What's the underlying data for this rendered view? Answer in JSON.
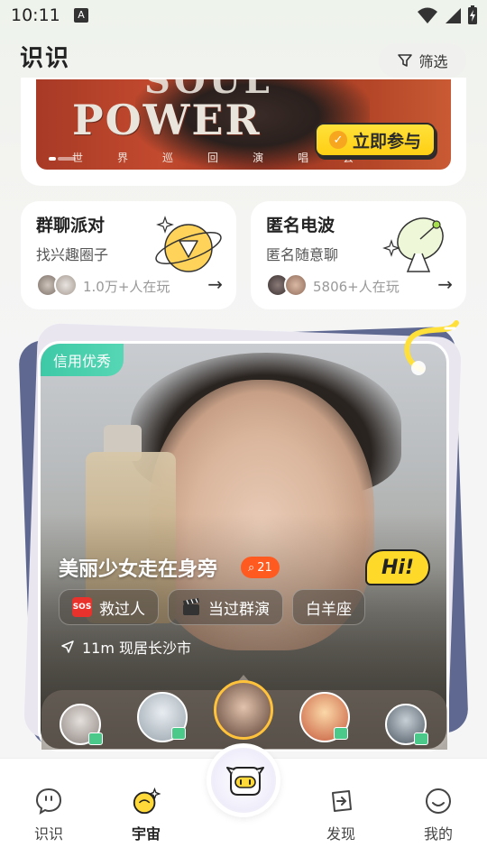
{
  "status_bar": {
    "time": "10:11",
    "notification_icon": "A"
  },
  "header": {
    "title": "识识",
    "filter_label": "筛选"
  },
  "banner": {
    "headline_top": "SOUL",
    "headline": "POWER",
    "subtitle_chars": [
      "世",
      "界",
      "巡",
      "回",
      "演",
      "唱",
      "会"
    ],
    "join_label": "立即参与"
  },
  "cards": [
    {
      "title": "群聊派对",
      "subtitle": "找兴趣圈子",
      "count": "1.0万+人在玩"
    },
    {
      "title": "匿名电波",
      "subtitle": "匿名随意聊",
      "count": "5806+人在玩"
    }
  ],
  "profile": {
    "credit_badge": "信用优秀",
    "name": "美丽少女走在身旁",
    "badge_count": "21",
    "tags": [
      {
        "icon": "sos-icon",
        "emoji_text": "SOS",
        "label": "救过人",
        "color": "#e8322b"
      },
      {
        "icon": "clapperboard-icon",
        "emoji_text": "",
        "label": "当过群演",
        "color": "#333333"
      },
      {
        "icon": "",
        "emoji_text": "",
        "label": "白羊座",
        "color": ""
      }
    ],
    "location_text": "11m  现居长沙市",
    "hi_text": "Hi!"
  },
  "bottom_nav": [
    {
      "label": "识识",
      "icon": "chat-bubble-icon",
      "active": false
    },
    {
      "label": "宇宙",
      "icon": "planet-sparkle-icon",
      "active": true
    },
    {
      "label": "发现",
      "icon": "discover-icon",
      "active": false
    },
    {
      "label": "我的",
      "icon": "smiley-icon",
      "active": false
    }
  ],
  "colors": {
    "accent_green": "#3ec9a6",
    "accent_yellow": "#ffd92a",
    "badge_orange": "#ff5a1f"
  }
}
